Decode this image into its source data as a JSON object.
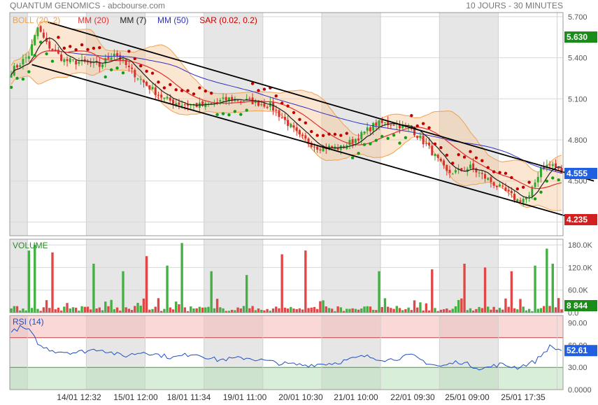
{
  "header": {
    "title": "QUANTUM GENOMICS - abcbourse.com",
    "period": "10 JOURS - 30 MINUTES"
  },
  "legend": [
    {
      "label": "BOLL (20, 2)",
      "color": "#f0a050"
    },
    {
      "label": "MM (20)",
      "color": "#e03030"
    },
    {
      "label": "MM (7)",
      "color": "#202020"
    },
    {
      "label": "MM (50)",
      "color": "#3030c0"
    },
    {
      "label": "SAR (0.02, 0.2)",
      "color": "#c00000"
    }
  ],
  "panels": {
    "volume_title": "VOLUME",
    "rsi_title": "RSI (14)"
  },
  "badges": {
    "high": {
      "text": "5.630",
      "color": "#1a8c1a"
    },
    "last": {
      "text": "4.555",
      "color": "#2060e0"
    },
    "low": {
      "text": "4.235",
      "color": "#d02020"
    },
    "volume": {
      "text": "8 844",
      "color": "#1a8c1a"
    },
    "rsi": {
      "text": "52.61",
      "color": "#2060e0"
    }
  },
  "chart_data": {
    "type": "candlestick",
    "price_axis": {
      "ticks": [
        "5.700",
        "5.400",
        "5.100",
        "4.800",
        "4.500",
        "4.200"
      ],
      "ylim": [
        4.1,
        5.73
      ]
    },
    "volume_axis": {
      "ticks": [
        "180.0K",
        "120.0K",
        "60.0K",
        "0.0"
      ],
      "ylim": [
        0,
        195000
      ]
    },
    "rsi_axis": {
      "ticks": [
        "90.00",
        "60.00",
        "30.00",
        "0.0000"
      ],
      "ylim": [
        0,
        100
      ],
      "overbought": 70,
      "oversold": 30
    },
    "x_labels": [
      "14/01 12:32",
      "15/01 12:00",
      "18/01 11:34",
      "19/01 11:00",
      "20/01 10:30",
      "21/01 10:00",
      "22/01 09:30",
      "25/01 09:00",
      "25/01 17:35"
    ],
    "bars_per_day": 20,
    "n_bars": 188,
    "close_anchors": [
      [
        0,
        5.3
      ],
      [
        6,
        5.42
      ],
      [
        9,
        5.62
      ],
      [
        12,
        5.5
      ],
      [
        18,
        5.38
      ],
      [
        26,
        5.36
      ],
      [
        30,
        5.34
      ],
      [
        35,
        5.44
      ],
      [
        40,
        5.32
      ],
      [
        46,
        5.2
      ],
      [
        52,
        5.1
      ],
      [
        58,
        5.06
      ],
      [
        66,
        5.05
      ],
      [
        74,
        5.1
      ],
      [
        82,
        5.08
      ],
      [
        88,
        5.05
      ],
      [
        94,
        4.92
      ],
      [
        98,
        4.82
      ],
      [
        104,
        4.75
      ],
      [
        112,
        4.74
      ],
      [
        118,
        4.82
      ],
      [
        124,
        4.92
      ],
      [
        130,
        4.92
      ],
      [
        136,
        4.88
      ],
      [
        142,
        4.74
      ],
      [
        148,
        4.56
      ],
      [
        152,
        4.57
      ],
      [
        156,
        4.6
      ],
      [
        160,
        4.54
      ],
      [
        164,
        4.48
      ],
      [
        168,
        4.42
      ],
      [
        172,
        4.36
      ],
      [
        176,
        4.38
      ],
      [
        180,
        4.6
      ],
      [
        184,
        4.62
      ],
      [
        187,
        4.555
      ]
    ],
    "rsi_anchors": [
      [
        0,
        77
      ],
      [
        3,
        84
      ],
      [
        6,
        80
      ],
      [
        10,
        58
      ],
      [
        15,
        52
      ],
      [
        22,
        50
      ],
      [
        30,
        55
      ],
      [
        38,
        45
      ],
      [
        45,
        51
      ],
      [
        55,
        43
      ],
      [
        62,
        49
      ],
      [
        70,
        40
      ],
      [
        80,
        43
      ],
      [
        92,
        35
      ],
      [
        100,
        33
      ],
      [
        110,
        36
      ],
      [
        120,
        45
      ],
      [
        128,
        40
      ],
      [
        136,
        46
      ],
      [
        142,
        35
      ],
      [
        146,
        31
      ],
      [
        152,
        38
      ],
      [
        160,
        28
      ],
      [
        166,
        34
      ],
      [
        172,
        30
      ],
      [
        178,
        38
      ],
      [
        183,
        58
      ],
      [
        187,
        52.61
      ]
    ],
    "volume_peaks": [
      [
        6,
        165000
      ],
      [
        8,
        180000
      ],
      [
        14,
        160000
      ],
      [
        28,
        130000
      ],
      [
        38,
        110000
      ],
      [
        46,
        150000
      ],
      [
        53,
        125000
      ],
      [
        58,
        185000
      ],
      [
        68,
        110000
      ],
      [
        80,
        100000
      ],
      [
        92,
        155000
      ],
      [
        100,
        165000
      ],
      [
        125,
        110000
      ],
      [
        143,
        115000
      ],
      [
        154,
        130000
      ],
      [
        161,
        120000
      ],
      [
        170,
        110000
      ],
      [
        178,
        125000
      ],
      [
        182,
        170000
      ],
      [
        184,
        130000
      ]
    ],
    "trendlines": [
      [
        {
          "x": 12.5,
          "y": 5.66
        },
        {
          "x": 198,
          "y": 4.5
        }
      ],
      [
        {
          "x": 7,
          "y": 5.35
        },
        {
          "x": 199,
          "y": 4.18
        }
      ]
    ],
    "series": [
      "BOLL (20, 2)",
      "MM (20)",
      "MM (7)",
      "MM (50)",
      "SAR (0.02, 0.2)",
      "VOLUME",
      "RSI (14)"
    ]
  }
}
